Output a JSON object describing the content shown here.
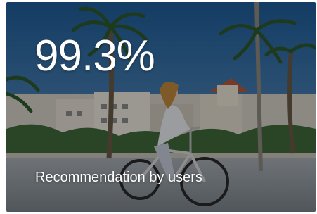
{
  "card": {
    "stat_value": "99.3%",
    "caption": "Recommendation by users",
    "photo": "woman-riding-bicycle-on-palm-lined-promenade",
    "overlay_color": "#000000"
  }
}
